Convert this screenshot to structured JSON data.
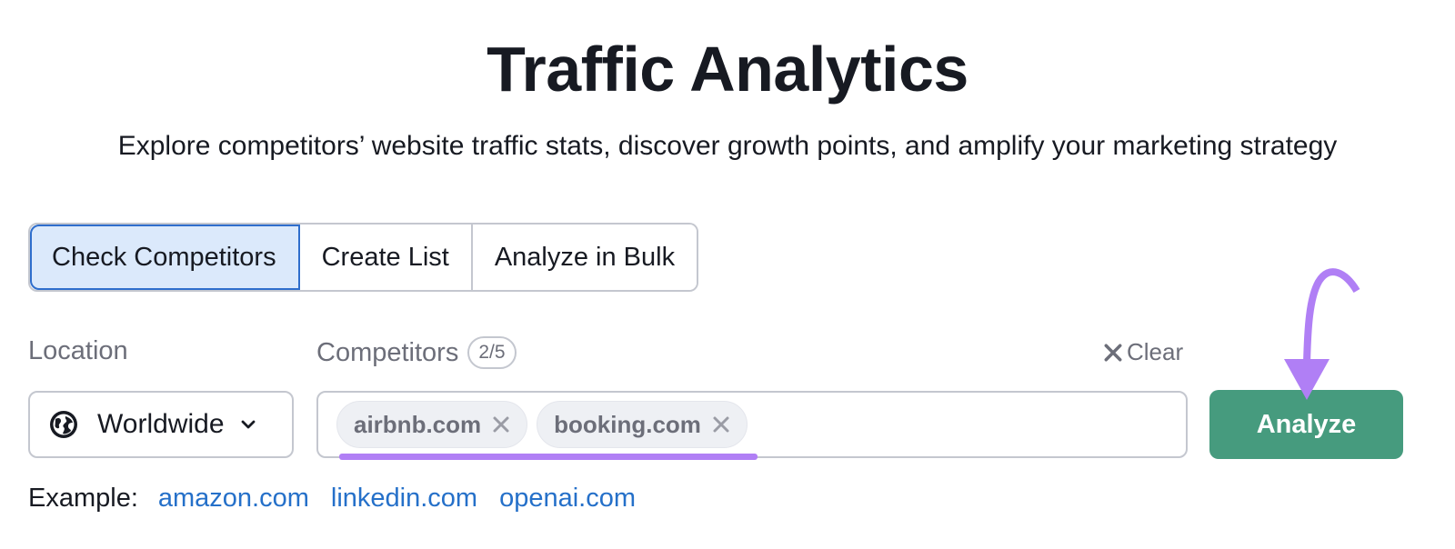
{
  "header": {
    "title": "Traffic Analytics",
    "subtitle": "Explore competitors’ website traffic stats, discover growth points, and amplify your marketing strategy"
  },
  "tabs": [
    {
      "label": "Check Competitors",
      "active": true
    },
    {
      "label": "Create List",
      "active": false
    },
    {
      "label": "Analyze in Bulk",
      "active": false
    }
  ],
  "location": {
    "label": "Location",
    "value": "Worldwide",
    "icon": "globe-icon"
  },
  "competitors": {
    "label": "Competitors",
    "count": "2/5",
    "clear_label": "Clear",
    "chips": [
      {
        "label": "airbnb.com"
      },
      {
        "label": "booking.com"
      }
    ]
  },
  "analyze_button": {
    "label": "Analyze"
  },
  "examples": {
    "label": "Example:",
    "links": [
      "amazon.com",
      "linkedin.com",
      "openai.com"
    ]
  },
  "colors": {
    "accent_blue": "#2570c9",
    "active_tab_bg": "#dbe9fb",
    "analyze_green": "#469b7e",
    "annotation_purple": "#b07ff5"
  }
}
